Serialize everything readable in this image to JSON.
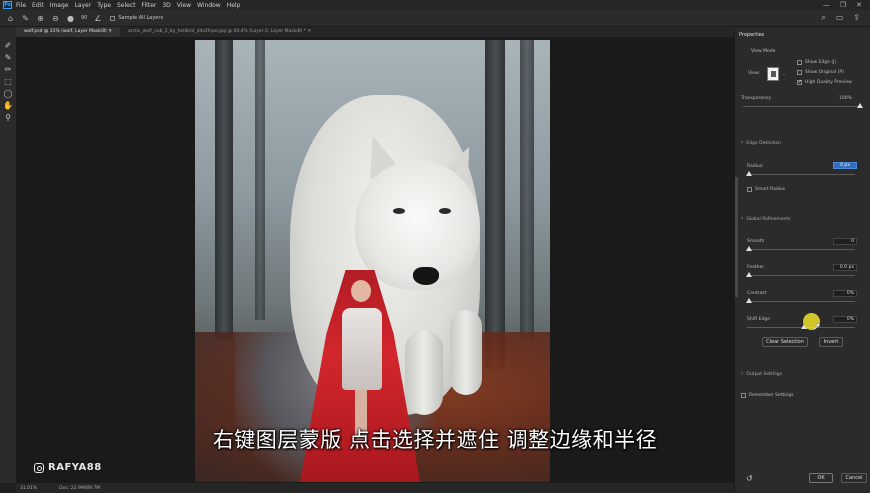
{
  "app": {
    "logo": "Ps"
  },
  "menu": [
    "File",
    "Edit",
    "Image",
    "Layer",
    "Type",
    "Select",
    "Filter",
    "3D",
    "View",
    "Window",
    "Help"
  ],
  "window_controls": [
    "—",
    "❐",
    "✕"
  ],
  "options_bar": {
    "brush_size": "90",
    "sample_all_layers": "Sample All Layers"
  },
  "tabs": [
    {
      "label": "wolf.psd @ 31% (wolf, Layer Mask/8)",
      "active": true
    },
    {
      "label": "arctic_wolf_cub_2_by_hellbrid_d4s2fnpe.jpg @ 44.4% (Layer 0, Layer Mask/8) *",
      "active": false
    }
  ],
  "status": {
    "zoom": "31.01%",
    "doc": "Doc: 22.9M/89.7M"
  },
  "subtitle": "右键图层蒙版 点击选择并遮住 调整边缘和半径",
  "watermark": "RAFYA88",
  "properties": {
    "title": "Properties",
    "view_mode": "View Mode",
    "view_label": "View:",
    "show_edge": "Show Edge (J)",
    "show_original": "Show Original (P)",
    "high_quality": "High Quality Preview",
    "transparency_label": "Transparency",
    "transparency_value": "100%",
    "edge_detection": "Edge Detection",
    "radius_label": "Radius:",
    "radius_value": "0 px",
    "smart_radius": "Smart Radius",
    "global_refinements": "Global Refinements",
    "smooth_label": "Smooth",
    "smooth_value": "0",
    "feather_label": "Feather",
    "feather_value": "0.0 px",
    "contrast_label": "Contrast",
    "contrast_value": "0%",
    "shift_edge_label": "Shift Edge",
    "shift_edge_value": "0%",
    "clear_selection": "Clear Selection",
    "invert": "Invert",
    "output_settings": "Output Settings",
    "remember_settings": "Remember Settings",
    "ok": "OK",
    "cancel": "Cancel"
  }
}
